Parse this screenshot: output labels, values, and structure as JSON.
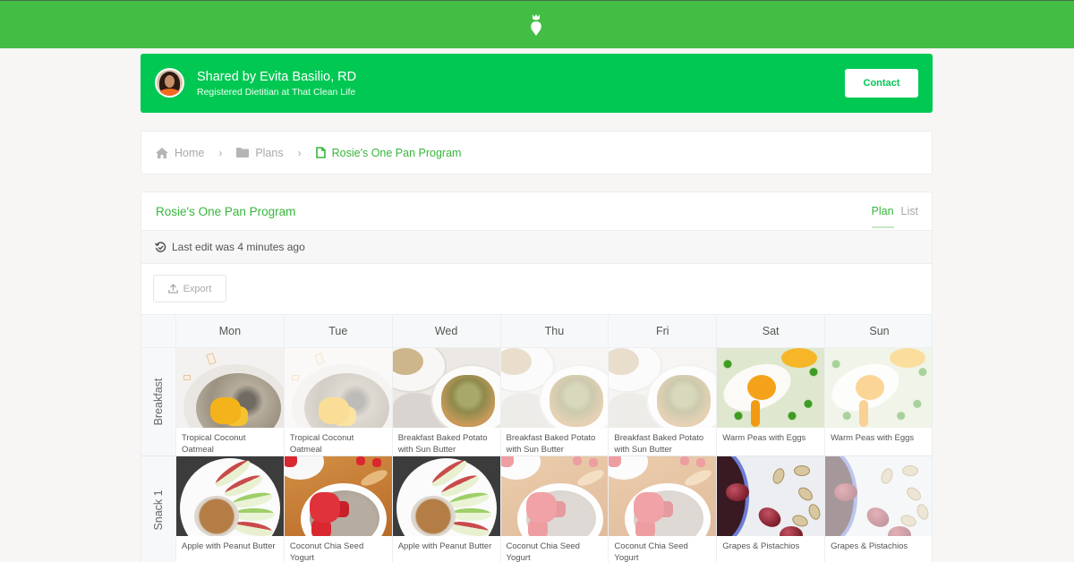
{
  "app": {
    "logo_icon": "carrot-logo-icon",
    "brand_color": "#44bd45",
    "banner_color": "#00c853",
    "accent_color": "#36b63a"
  },
  "share_banner": {
    "title": "Shared by Evita Basilio, RD",
    "subtitle": "Registered Dietitian at That Clean Life",
    "contact_label": "Contact",
    "avatar_icon": "avatar-photo"
  },
  "breadcrumb": {
    "items": [
      {
        "label": "Home",
        "icon": "home-icon"
      },
      {
        "label": "Plans",
        "icon": "folder-icon"
      },
      {
        "label": "Rosie's One Pan Program",
        "icon": "document-icon"
      }
    ],
    "separator": "›"
  },
  "plan": {
    "title": "Rosie's One Pan Program",
    "tabs": [
      {
        "label": "Plan",
        "active": true
      },
      {
        "label": "List",
        "active": false
      }
    ],
    "last_edit": "Last edit was 4 minutes ago",
    "export_label": "Export",
    "days": [
      "Mon",
      "Tue",
      "Wed",
      "Thu",
      "Fri",
      "Sat",
      "Sun"
    ],
    "rows": [
      {
        "label": "Breakfast",
        "cells": [
          {
            "name": "Tropical Coconut Oatmeal",
            "photo": "oatmeal",
            "faded": false
          },
          {
            "name": "Tropical Coconut Oatmeal",
            "photo": "oatmeal",
            "faded": true
          },
          {
            "name": "Breakfast Baked Potato with Sun Butter",
            "photo": "potato",
            "faded": false
          },
          {
            "name": "Breakfast Baked Potato with Sun Butter",
            "photo": "potato",
            "faded": true
          },
          {
            "name": "Breakfast Baked Potato with Sun Butter",
            "photo": "potato",
            "faded": true
          },
          {
            "name": "Warm Peas with Eggs",
            "photo": "eggs",
            "faded": false
          },
          {
            "name": "Warm Peas with Eggs",
            "photo": "eggs",
            "faded": true
          }
        ]
      },
      {
        "label": "Snack 1",
        "cells": [
          {
            "name": "Apple with Peanut Butter",
            "photo": "apple",
            "faded": false
          },
          {
            "name": "Coconut Chia Seed Yogurt",
            "photo": "chia",
            "faded": false
          },
          {
            "name": "Apple with Peanut Butter",
            "photo": "apple",
            "faded": false
          },
          {
            "name": "Coconut Chia Seed Yogurt",
            "photo": "chia",
            "faded": true
          },
          {
            "name": "Coconut Chia Seed Yogurt",
            "photo": "chia",
            "faded": true
          },
          {
            "name": "Grapes & Pistachios",
            "photo": "grapes",
            "faded": false
          },
          {
            "name": "Grapes & Pistachios",
            "photo": "grapes",
            "faded": true
          }
        ]
      }
    ]
  }
}
